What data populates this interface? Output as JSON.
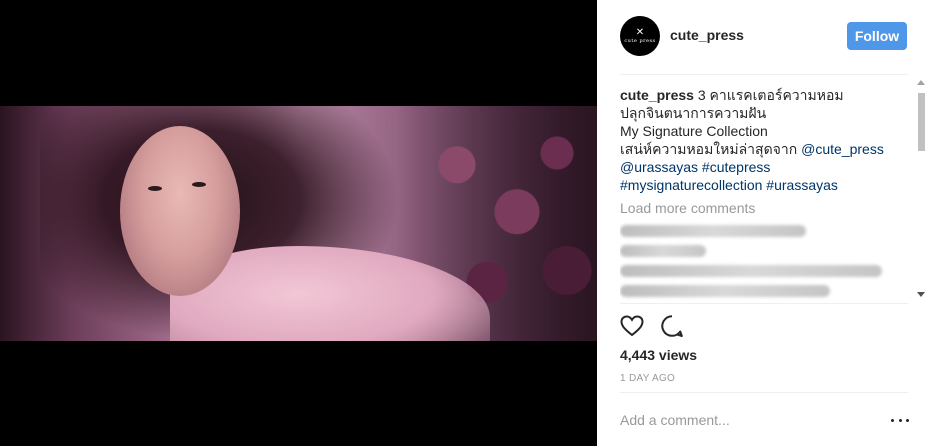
{
  "post": {
    "username": "cute_press",
    "follow_label": "Follow",
    "avatar": {
      "mark": "✕",
      "text": "cute press"
    }
  },
  "caption": {
    "user": "cute_press",
    "line1": " 3 คาแรคเตอร์ความหอม",
    "line2": "ปลุกจินตนาการความฝัน",
    "line3": "My Signature Collection",
    "line4_text": "เสน่ห์ความหอมใหม่ล่าสุดจาก ",
    "mention1": "@cute_press",
    "mention2": "@urassayas",
    "hashtag1": "#cutepress",
    "hashtag2": "#mysignaturecollection",
    "hashtag3": "#urassayas"
  },
  "comments": {
    "load_more": "Load more comments"
  },
  "actions": {
    "like_icon": "heart-icon",
    "comment_icon": "comment-icon"
  },
  "stats": {
    "views": "4,443 views",
    "date": "1 DAY AGO"
  },
  "add_comment": {
    "placeholder": "Add a comment..."
  },
  "colors": {
    "follow_bg": "#4f98e9",
    "link": "#003569",
    "muted": "#999999"
  }
}
